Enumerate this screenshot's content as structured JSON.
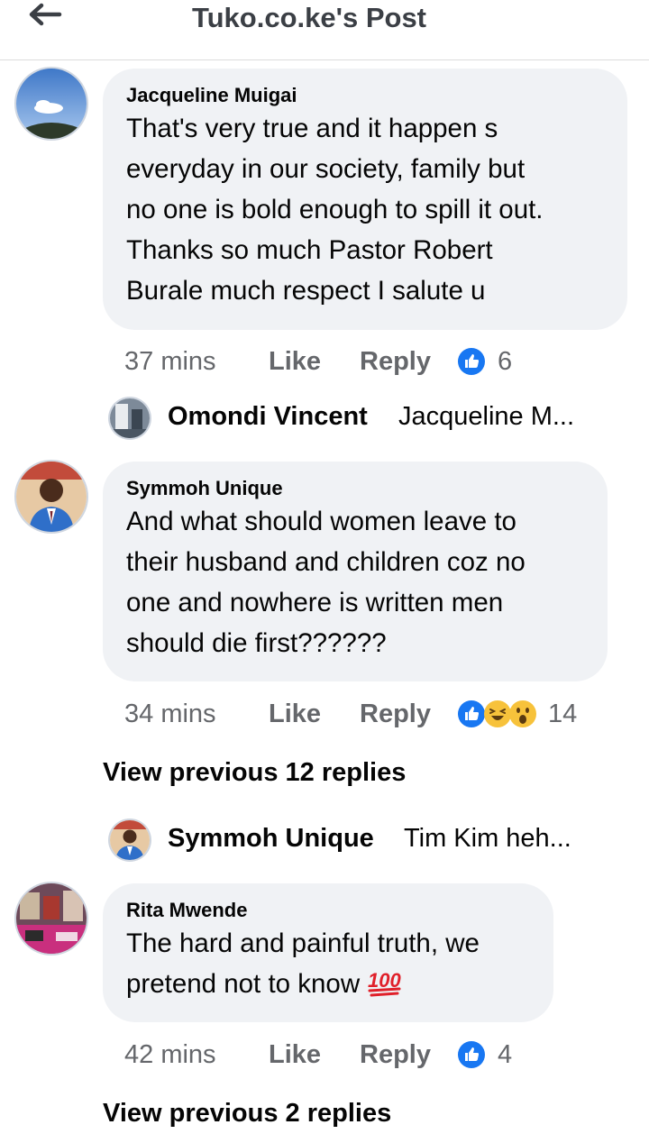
{
  "header": {
    "title": "Tuko.co.ke's Post"
  },
  "comments": [
    {
      "author": "Jacqueline Muigai",
      "lines": [
        "That's very true and it happen s",
        "everyday in our society, family but",
        "no one is bold enough to spill it out.",
        "Thanks so much Pastor Robert",
        "Burale much respect I salute u"
      ],
      "time": "37 mins",
      "like": "Like",
      "reply": "Reply",
      "reactions": "6"
    },
    {
      "author": "Symmoh Unique",
      "lines": [
        "And what should women leave to",
        "their husband and children coz no",
        "one and nowhere is written men",
        "should die first??????"
      ],
      "time": "34 mins",
      "like": "Like",
      "reply": "Reply",
      "reactions": "14"
    },
    {
      "author": "Rita Mwende",
      "lines": [
        "The hard and painful truth, we",
        "pretend not to know"
      ],
      "emoji": "100",
      "time": "42 mins",
      "like": "Like",
      "reply": "Reply",
      "reactions": "4"
    }
  ],
  "replies": [
    {
      "name": "Omondi Vincent",
      "snippet": "Jacqueline M..."
    },
    {
      "name": "Symmoh Unique",
      "snippet": "Tim Kim heh..."
    }
  ],
  "view_previous": [
    "View previous 12 replies",
    "View previous 2 replies"
  ],
  "colors": {
    "like_blue": "#1877f2",
    "bubble": "#f0f2f5",
    "meta_gray": "#65676b"
  }
}
